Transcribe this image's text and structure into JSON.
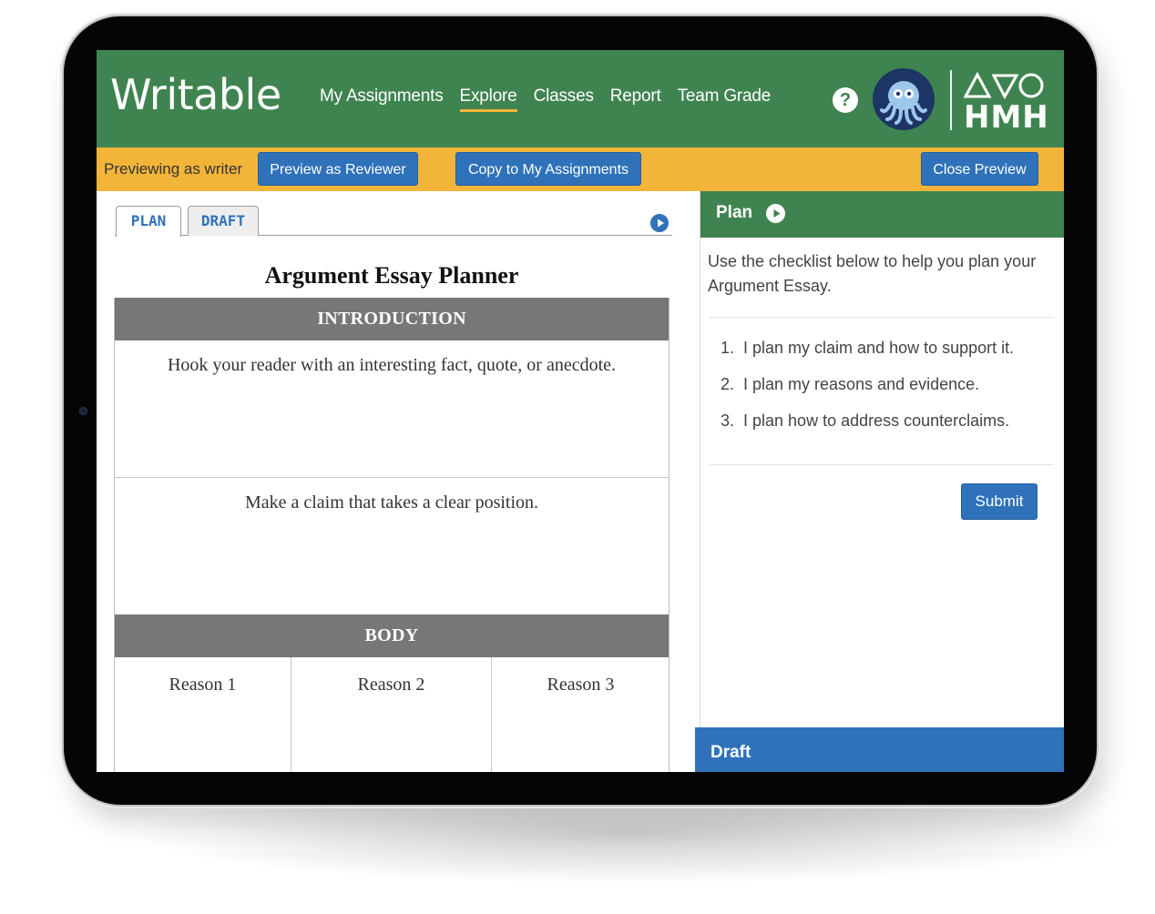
{
  "app": {
    "logo": "Writable",
    "nav": [
      {
        "label": "My Assignments",
        "active": false
      },
      {
        "label": "Explore",
        "active": true
      },
      {
        "label": "Classes",
        "active": false
      },
      {
        "label": "Report",
        "active": false
      },
      {
        "label": "Team Grade",
        "active": false
      }
    ],
    "help_icon": "?",
    "brand": "HMH"
  },
  "preview_bar": {
    "label": "Previewing as writer",
    "preview_reviewer": "Preview as Reviewer",
    "copy": "Copy to My Assignments",
    "close": "Close Preview"
  },
  "editor": {
    "tabs": [
      {
        "label": "PLAN",
        "active": true
      },
      {
        "label": "DRAFT",
        "active": false
      }
    ],
    "title": "Argument Essay Planner",
    "introduction": {
      "heading": "INTRODUCTION",
      "hook": "Hook your reader with an interesting fact, quote, or anecdote.",
      "claim": "Make a claim that takes a clear position."
    },
    "body": {
      "heading": "BODY",
      "reasons": [
        "Reason 1",
        "Reason 2",
        "Reason 3"
      ]
    }
  },
  "plan_panel": {
    "title": "Plan",
    "intro": "Use the checklist below to help you plan your Argument Essay.",
    "checklist": [
      "1.  I plan my claim and how to support it.",
      "2.  I plan my reasons and evidence.",
      "3.  I plan how to address counterclaims."
    ],
    "submit": "Submit"
  },
  "draft_panel": {
    "title": "Draft"
  },
  "colors": {
    "header_green": "#3f8450",
    "preview_yellow": "#f2b53a",
    "button_blue": "#2f72b9",
    "section_gray": "#777777"
  }
}
